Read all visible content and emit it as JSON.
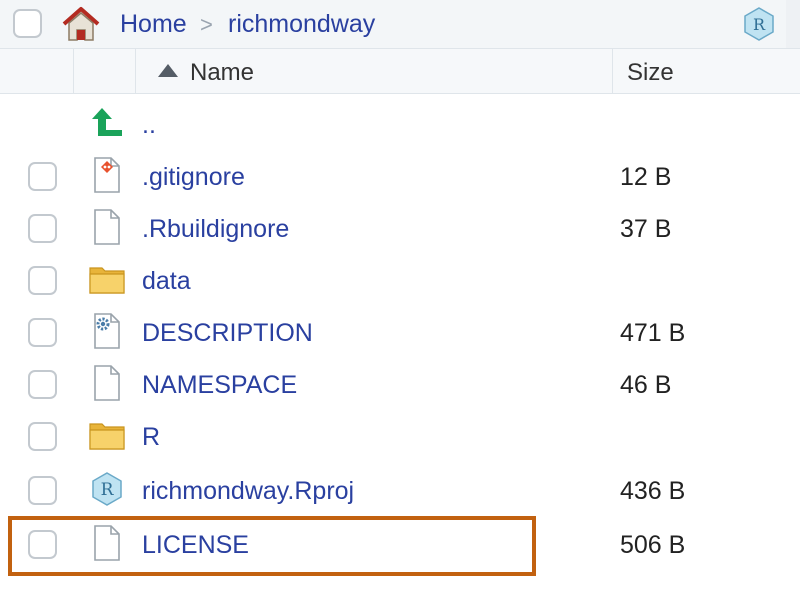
{
  "breadcrumb": {
    "home": "Home",
    "separator": ">",
    "current": "richmondway"
  },
  "columns": {
    "name": "Name",
    "size": "Size"
  },
  "parent": {
    "label": ".."
  },
  "files": [
    {
      "name": ".gitignore",
      "size": "12 B",
      "icon": "git-file-icon"
    },
    {
      "name": ".Rbuildignore",
      "size": "37 B",
      "icon": "file-icon"
    },
    {
      "name": "data",
      "size": "",
      "icon": "folder-icon"
    },
    {
      "name": "DESCRIPTION",
      "size": "471 B",
      "icon": "description-gear-icon"
    },
    {
      "name": "NAMESPACE",
      "size": "46 B",
      "icon": "file-icon"
    },
    {
      "name": "R",
      "size": "",
      "icon": "folder-icon"
    },
    {
      "name": "richmondway.Rproj",
      "size": "436 B",
      "icon": "rproj-icon"
    },
    {
      "name": "LICENSE",
      "size": "506 B",
      "icon": "file-icon"
    }
  ],
  "colors": {
    "link": "#2a40a0",
    "highlight": "#c2610f",
    "folder": "#f2c94c",
    "git": "#e8522e",
    "up_arrow": "#1aa35a"
  }
}
